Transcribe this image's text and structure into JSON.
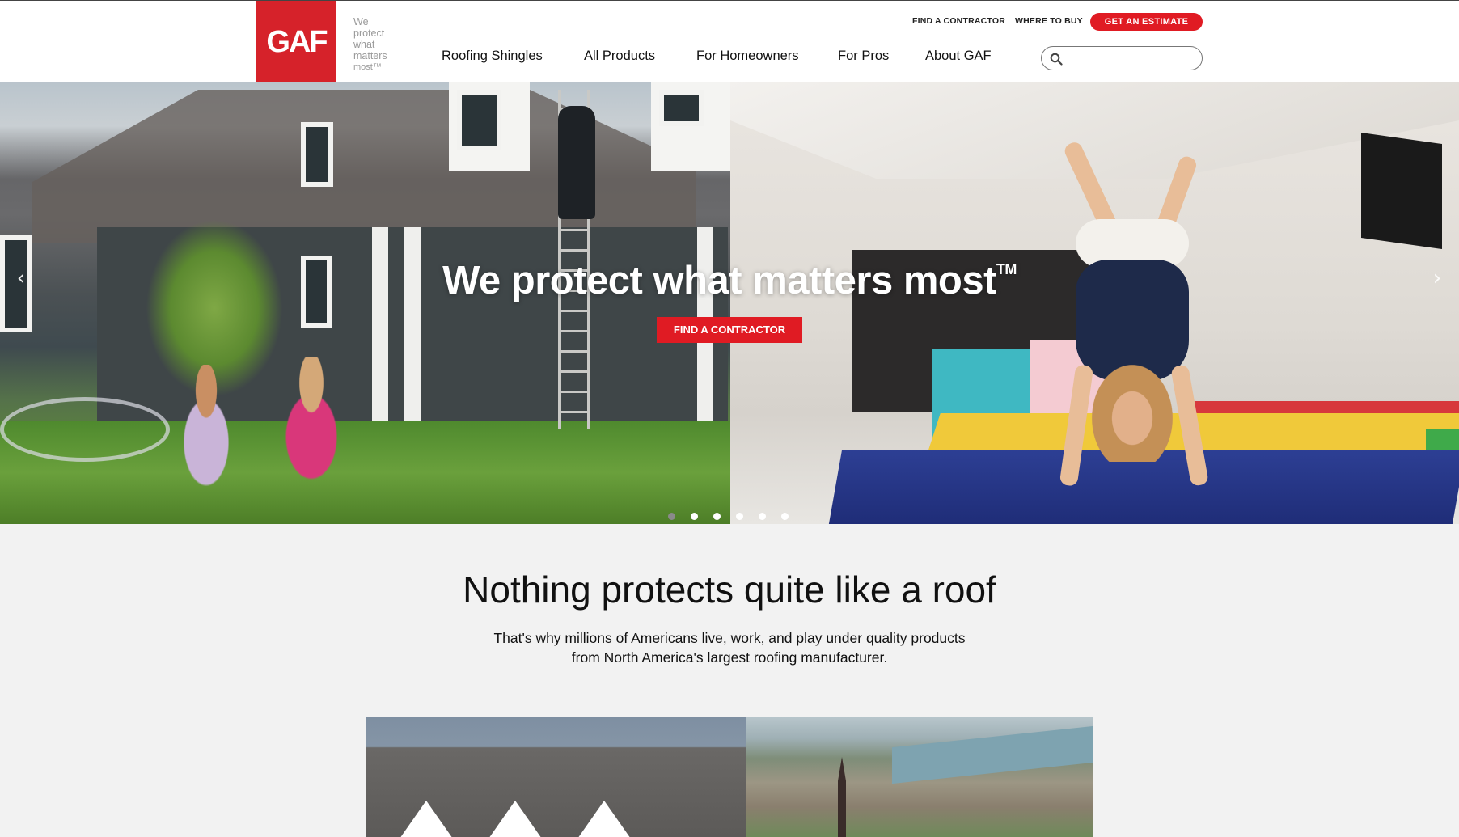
{
  "header": {
    "logo_text": "GAF",
    "tagline": [
      "We",
      "protect",
      "what",
      "matters",
      "most™"
    ],
    "utility_links": [
      "FIND A CONTRACTOR",
      "WHERE TO BUY"
    ],
    "estimate_label": "GET AN ESTIMATE",
    "nav": [
      "Roofing Shingles",
      "All Products",
      "For Homeowners",
      "For Pros",
      "About GAF"
    ],
    "search": {
      "value": "",
      "placeholder": ""
    }
  },
  "hero": {
    "title": "We protect what matters most",
    "trademark": "TM",
    "cta_label": "FIND A CONTRACTOR",
    "prev_arrow": "‹",
    "next_arrow": "›",
    "slide_count": 6,
    "active_slide": 1
  },
  "intro": {
    "title": "Nothing protects quite like a roof",
    "text": [
      "That's why millions of Americans live, work, and play under quality products",
      "from North America's largest roofing manufacturer."
    ]
  },
  "colors": {
    "brand_red": "#d6222a",
    "button_red": "#e01b23",
    "page_bg": "#f2f2f2"
  },
  "icons": [
    "search-icon",
    "chevron-left-icon",
    "chevron-right-icon"
  ]
}
